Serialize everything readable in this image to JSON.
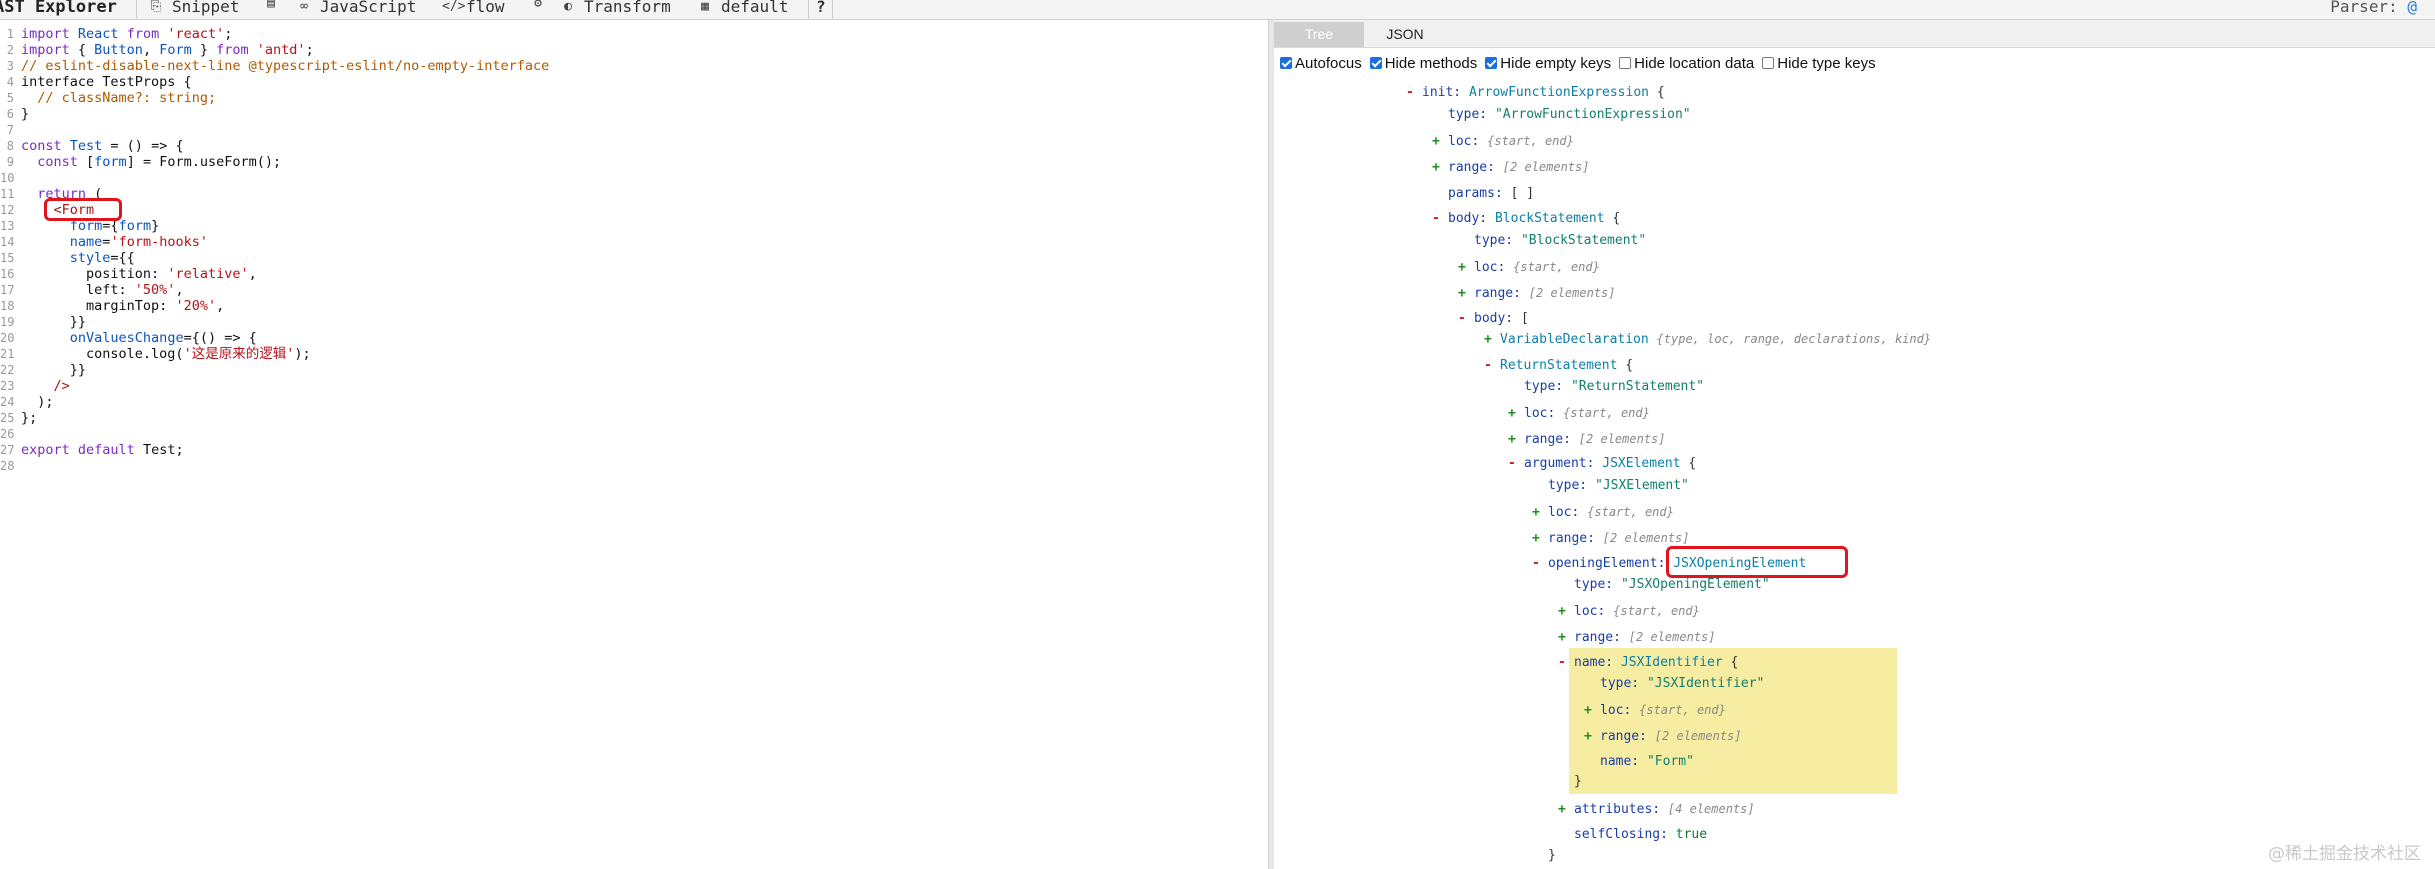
{
  "toolbar": {
    "brand": "AST Explorer",
    "snippet": "Snippet",
    "language": "JavaScript",
    "parser_name": "flow",
    "transform": "Transform",
    "default": "default",
    "help": "?",
    "parser_label": "Parser:",
    "parser_value": "@"
  },
  "code": {
    "lines": [
      "import React from 'react';",
      "import { Button, Form } from 'antd';",
      "// eslint-disable-next-line @typescript-eslint/no-empty-interface",
      "interface TestProps {",
      "  // className?: string;",
      "}",
      "",
      "const Test = () => {",
      "  const [form] = Form.useForm();",
      "",
      "  return (",
      "    <Form",
      "      form={form}",
      "      name='form-hooks'",
      "      style={{",
      "        position: 'relative',",
      "        left: '50%',",
      "        marginTop: '20%',",
      "      }}",
      "      onValuesChange={() => {",
      "        console.log('这是原来的逻辑');",
      "      }}",
      "    />",
      "  );",
      "};",
      "",
      "export default Test;",
      ""
    ]
  },
  "panel": {
    "tabs": [
      "Tree",
      "JSON"
    ],
    "options": [
      {
        "label": "Autofocus",
        "checked": true
      },
      {
        "label": "Hide methods",
        "checked": true
      },
      {
        "label": "Hide empty keys",
        "checked": true
      },
      {
        "label": "Hide location data",
        "checked": false
      },
      {
        "label": "Hide type keys",
        "checked": false
      }
    ]
  },
  "tree": {
    "n1_key": "init:",
    "n1_type": "ArrowFunctionExpression",
    "n1_brace": "{",
    "n2_key": "type:",
    "n2_val": "\"ArrowFunctionExpression\"",
    "n3_key": "loc:",
    "n3_meta": "{start, end}",
    "n4_key": "range:",
    "n4_meta": "[2 elements]",
    "n5_key": "params:",
    "n5_val": "[ ]",
    "n6_key": "body:",
    "n6_type": "BlockStatement",
    "n6_brace": "{",
    "n7_key": "type:",
    "n7_val": "\"BlockStatement\"",
    "n8_key": "loc:",
    "n8_meta": "{start, end}",
    "n9_key": "range:",
    "n9_meta": "[2 elements]",
    "n10_key": "body:",
    "n10_val": "[",
    "n11_type": "VariableDeclaration",
    "n11_meta": "{type, loc, range, declarations, kind}",
    "n12_type": "ReturnStatement",
    "n12_brace": "{",
    "n13_key": "type:",
    "n13_val": "\"ReturnStatement\"",
    "n14_key": "loc:",
    "n14_meta": "{start, end}",
    "n15_key": "range:",
    "n15_meta": "[2 elements]",
    "n16_key": "argument:",
    "n16_type": "JSXElement",
    "n16_brace": "{",
    "n17_key": "type:",
    "n17_val": "\"JSXElement\"",
    "n18_key": "loc:",
    "n18_meta": "{start, end}",
    "n19_key": "range:",
    "n19_meta": "[2 elements]",
    "n20_key": "openingElement:",
    "n20_type": "JSXOpeningElement",
    "n21_key": "type:",
    "n21_val": "\"JSXOpeningElement\"",
    "n22_key": "loc:",
    "n22_meta": "{start, end}",
    "n23_key": "range:",
    "n23_meta": "[2 elements]",
    "n24_key": "name:",
    "n24_type": "JSXIdentifier",
    "n24_brace": "{",
    "n25_key": "type:",
    "n25_val": "\"JSXIdentifier\"",
    "n26_key": "loc:",
    "n26_meta": "{start, end}",
    "n27_key": "range:",
    "n27_meta": "[2 elements]",
    "n28_key": "name:",
    "n28_val": "\"Form\"",
    "n29_brace": "}",
    "n30_key": "attributes:",
    "n30_meta": "[4 elements]",
    "n31_key": "selfClosing:",
    "n31_val": "true",
    "n32_brace": "}"
  },
  "watermark": "@稀土掘金技术社区",
  "colors": {
    "highlight_box": "#e0141c",
    "yellow_highlight": "#f7eda2",
    "tab_active": "#cfcfcf"
  }
}
